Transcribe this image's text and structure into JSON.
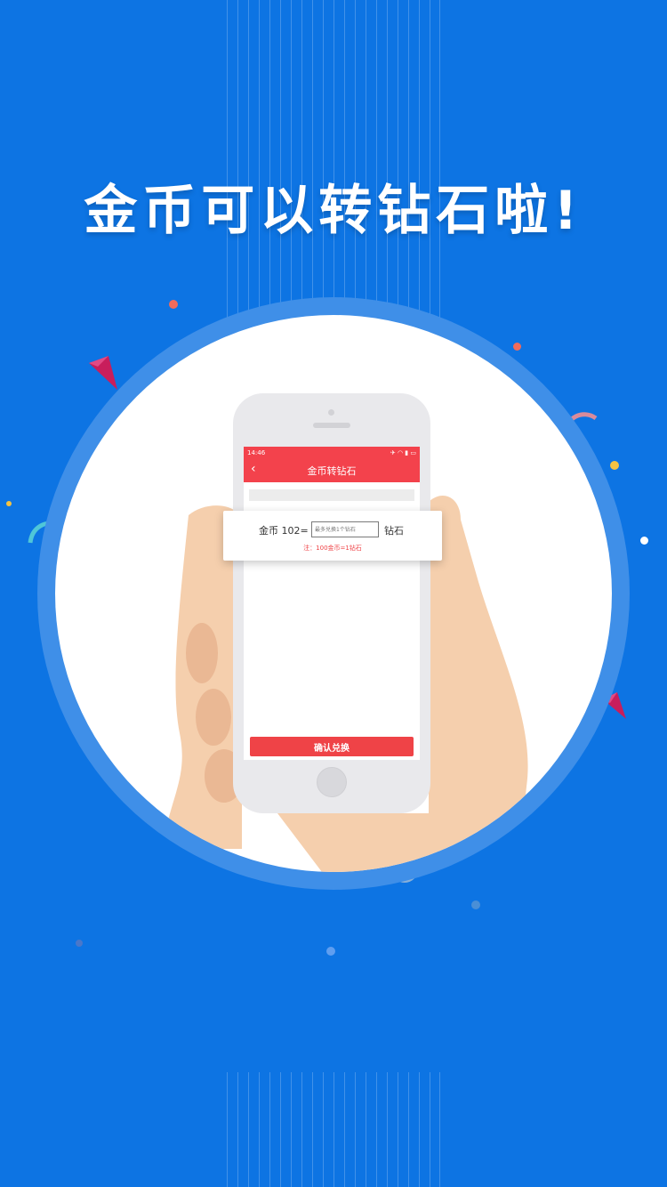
{
  "headline": "金币可以转钻石啦!",
  "phone": {
    "status_time": "14:46",
    "status_icons": "✈ ◠ ▮ ▭",
    "nav_title": "金币转钻石",
    "back_icon": "‹",
    "gold_label": "金币 102=",
    "input_placeholder": "最多兑换1个钻石",
    "diamond_label": "钻石",
    "note": "注：100金币=1钻石",
    "confirm_label": "确认兑换"
  },
  "colors": {
    "background": "#0d74e3",
    "accent_red": "#f3424c",
    "skin": "#f5cfad"
  }
}
